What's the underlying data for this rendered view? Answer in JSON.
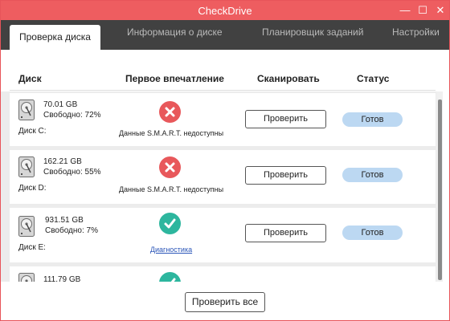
{
  "window": {
    "title": "CheckDrive",
    "minimize_glyph": "—",
    "maximize_glyph": "☐",
    "close_glyph": "✕",
    "accent_color": "#ee5d60"
  },
  "tabs": [
    {
      "label": "Проверка диска",
      "active": true
    },
    {
      "label": "Информация о диске",
      "active": false
    },
    {
      "label": "Планировщик заданий",
      "active": false
    },
    {
      "label": "Настройки",
      "active": false
    }
  ],
  "columns": {
    "disk": "Диск",
    "impression": "Первое впечатление",
    "scan": "Сканировать",
    "status": "Статус"
  },
  "drives": [
    {
      "size": "70.01 GB",
      "free": "Свободно: 72%",
      "name": "Диск C:",
      "health": "bad",
      "health_icon": "x-circle-icon",
      "impression": "Данные S.M.A.R.T. недоступны",
      "impression_is_link": false,
      "scan_label": "Проверить",
      "status": "Готов"
    },
    {
      "size": "162.21 GB",
      "free": "Свободно: 55%",
      "name": "Диск D:",
      "health": "bad",
      "health_icon": "x-circle-icon",
      "impression": "Данные S.M.A.R.T. недоступны",
      "impression_is_link": false,
      "scan_label": "Проверить",
      "status": "Готов"
    },
    {
      "size": "931.51 GB",
      "free": "Свободно: 7%",
      "name": "Диск E:",
      "health": "good",
      "health_icon": "check-circle-icon",
      "impression": "Диагностика",
      "impression_is_link": true,
      "scan_label": "Проверить",
      "status": "Готов"
    },
    {
      "size": "111.79 GB",
      "health": "good",
      "health_icon": "check-circle-icon"
    }
  ],
  "footer": {
    "check_all_label": "Проверить все"
  },
  "colors": {
    "bad": "#e8585b",
    "good": "#2db69e",
    "status_badge": "#bcd8f2",
    "tab_bar": "#414141"
  }
}
